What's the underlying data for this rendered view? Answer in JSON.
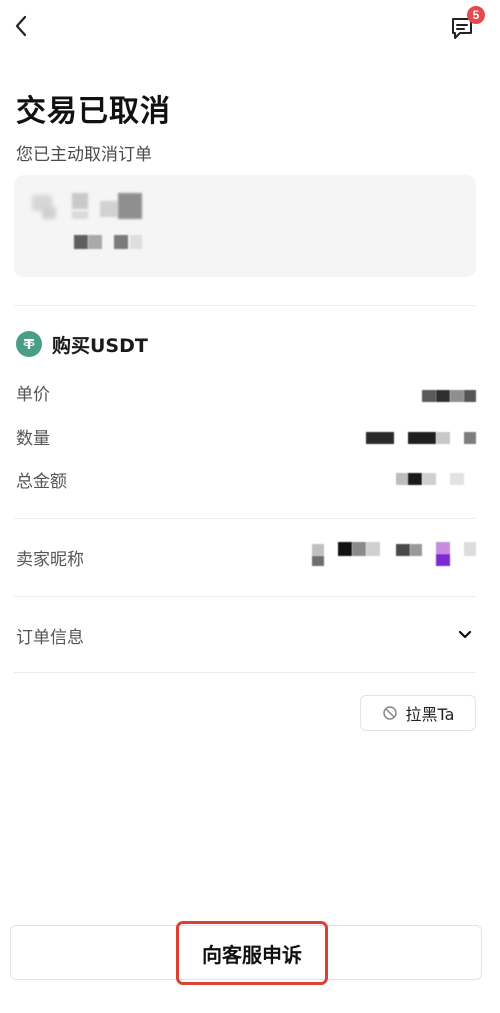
{
  "header": {
    "back_icon": "chevron-left-icon",
    "chat_icon": "message-icon",
    "chat_badge": "5"
  },
  "status": {
    "title": "交易已取消",
    "subtitle": "您已主动取消订单"
  },
  "order": {
    "asset_label": "购买USDT",
    "asset_icon": "tether-icon",
    "fields": {
      "unit_price": "单价",
      "quantity": "数量",
      "total": "总金额",
      "seller_nickname": "卖家昵称"
    }
  },
  "order_info": {
    "label": "订单信息"
  },
  "actions": {
    "block_label": "拉黑Ta",
    "appeal_label": "向客服申诉"
  },
  "colors": {
    "badge": "#e5484d",
    "usdt": "#4a9e86",
    "appeal_highlight": "#d9432f"
  }
}
